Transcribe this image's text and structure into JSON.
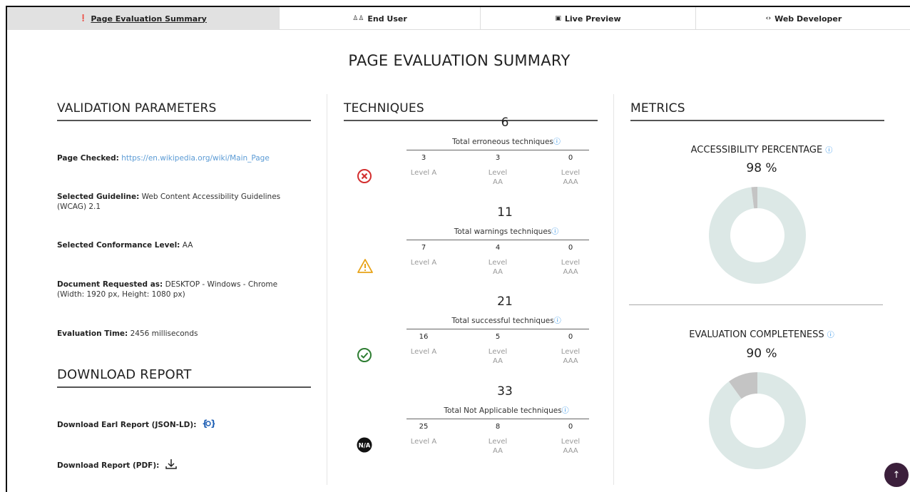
{
  "tabs": [
    {
      "label": "Page Evaluation Summary",
      "icon": "info-icon"
    },
    {
      "label": "End User",
      "icon": "users-icon"
    },
    {
      "label": "Live Preview",
      "icon": "preview-icon"
    },
    {
      "label": "Web Developer",
      "icon": "code-icon"
    }
  ],
  "page_title": "PAGE EVALUATION SUMMARY",
  "validation": {
    "heading": "VALIDATION PARAMETERS",
    "page_checked_label": "Page Checked:",
    "page_checked_value": "https://en.wikipedia.org/wiki/Main_Page",
    "guideline_label": "Selected Guideline:",
    "guideline_value": "Web Content Accessibility Guidelines (WCAG) 2.1",
    "conformance_label": "Selected Conformance Level:",
    "conformance_value": "AA",
    "document_label": "Document Requested as:",
    "document_value": "DESKTOP - Windows - Chrome (Width: 1920 px, Height: 1080 px)",
    "evaltime_label": "Evaluation Time:",
    "evaltime_value": "2456 milliseconds"
  },
  "download": {
    "heading": "DOWNLOAD REPORT",
    "earl_label": "Download Earl Report (JSON-LD):",
    "pdf_label": "Download Report (PDF):"
  },
  "techniques": {
    "heading": "TECHNIQUES",
    "groups": [
      {
        "icon": "error-icon",
        "count": "6",
        "label": "Total erroneous techniques",
        "levels": [
          {
            "value": "3",
            "name": "Level A"
          },
          {
            "value": "3",
            "name": "Level AA"
          },
          {
            "value": "0",
            "name": "Level AAA"
          }
        ]
      },
      {
        "icon": "warning-icon",
        "count": "11",
        "label": "Total warnings techniques",
        "levels": [
          {
            "value": "7",
            "name": "Level A"
          },
          {
            "value": "4",
            "name": "Level AA"
          },
          {
            "value": "0",
            "name": "Level AAA"
          }
        ]
      },
      {
        "icon": "success-icon",
        "count": "21",
        "label": "Total successful techniques",
        "levels": [
          {
            "value": "16",
            "name": "Level A"
          },
          {
            "value": "5",
            "name": "Level AA"
          },
          {
            "value": "0",
            "name": "Level AAA"
          }
        ]
      },
      {
        "icon": "not-applicable-icon",
        "count": "33",
        "label": "Total Not Applicable techniques",
        "levels": [
          {
            "value": "25",
            "name": "Level A"
          },
          {
            "value": "8",
            "name": "Level AA"
          },
          {
            "value": "0",
            "name": "Level AAA"
          }
        ]
      }
    ]
  },
  "metrics": {
    "heading": "METRICS",
    "accessibility": {
      "title": "ACCESSIBILITY PERCENTAGE",
      "value": "98 %",
      "fraction": 0.98
    },
    "completeness": {
      "title": "EVALUATION COMPLETENESS",
      "value": "90 %",
      "fraction": 0.9
    },
    "colors": {
      "filled": "#dce8e6",
      "remaining": "#c4c4c4"
    }
  },
  "scroll_top_icon": "arrow-up-icon"
}
